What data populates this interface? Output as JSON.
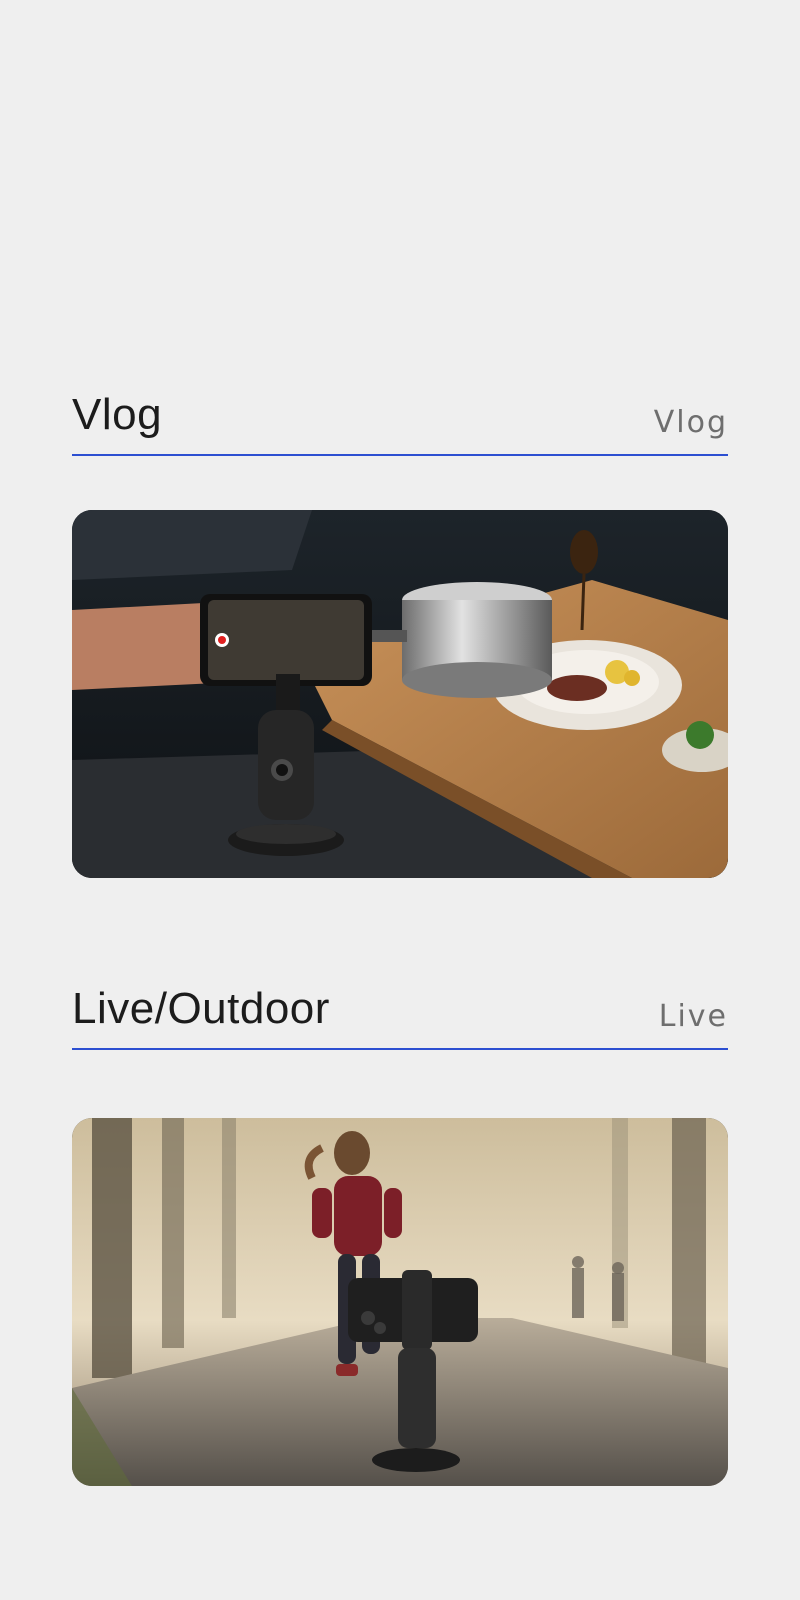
{
  "sections": [
    {
      "title": "Vlog",
      "subtitle": "Vlog",
      "image": "cooking-vlog-phone-tracker-photo"
    },
    {
      "title": "Live/Outdoor",
      "subtitle": "Live",
      "image": "runner-forest-path-phone-tracker-photo"
    }
  ],
  "colors": {
    "background": "#efefef",
    "divider": "#2c4fd1",
    "title": "#1c1c1c",
    "subtitle": "#6e6e6e"
  }
}
